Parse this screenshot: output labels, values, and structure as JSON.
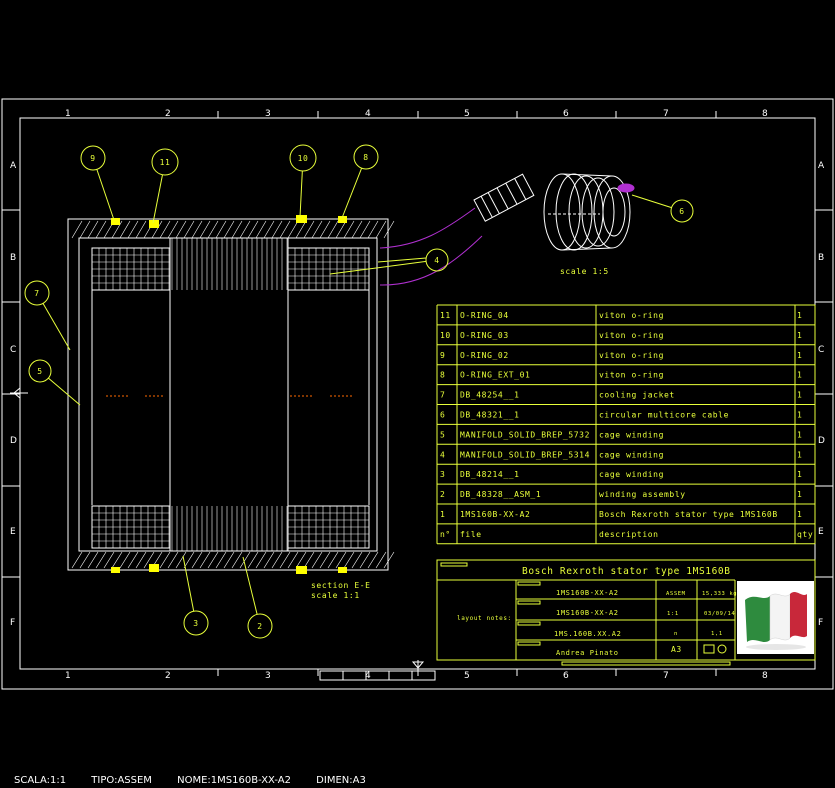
{
  "colors": {
    "border": "#ffffff",
    "yellow": "#e8ff3a",
    "part_yellow": "#ffff00",
    "purple": "#b030d0",
    "background": "#000000"
  },
  "frame": {
    "col_labels": [
      "1",
      "2",
      "3",
      "4",
      "5",
      "6",
      "7",
      "8"
    ],
    "row_labels": [
      "A",
      "B",
      "C",
      "D",
      "E",
      "F"
    ]
  },
  "balloons": [
    {
      "id": "balloon-9",
      "label": "9"
    },
    {
      "id": "balloon-11",
      "label": "11"
    },
    {
      "id": "balloon-10",
      "label": "10"
    },
    {
      "id": "balloon-8",
      "label": "8"
    },
    {
      "id": "balloon-4",
      "label": "4"
    },
    {
      "id": "balloon-6",
      "label": "6"
    },
    {
      "id": "balloon-7",
      "label": "7"
    },
    {
      "id": "balloon-5",
      "label": "5"
    },
    {
      "id": "balloon-3",
      "label": "3"
    },
    {
      "id": "balloon-2",
      "label": "2"
    }
  ],
  "views": {
    "section_label": "section E-E",
    "section_scale": "scale 1:1",
    "iso_scale": "scale 1:5"
  },
  "bom": {
    "rows": [
      {
        "n": "11",
        "file": "O-RING_04",
        "desc": "viton o-ring",
        "qty": "1"
      },
      {
        "n": "10",
        "file": "O-RING_03",
        "desc": "viton o-ring",
        "qty": "1"
      },
      {
        "n": "9",
        "file": "O-RING_02",
        "desc": "viton o-ring",
        "qty": "1"
      },
      {
        "n": "8",
        "file": "O-RING_EXT_01",
        "desc": "viton o-ring",
        "qty": "1"
      },
      {
        "n": "7",
        "file": "DB_48254__1",
        "desc": "cooling jacket",
        "qty": "1"
      },
      {
        "n": "6",
        "file": "DB_48321__1",
        "desc": "circular multicore cable",
        "qty": "1"
      },
      {
        "n": "5",
        "file": "MANIFOLD_SOLID_BREP_5732",
        "desc": "cage winding",
        "qty": "1"
      },
      {
        "n": "4",
        "file": "MANIFOLD_SOLID_BREP_5314",
        "desc": "cage winding",
        "qty": "1"
      },
      {
        "n": "3",
        "file": "DB_48214__1",
        "desc": "cage winding",
        "qty": "1"
      },
      {
        "n": "2",
        "file": "DB_48328__ASM_1",
        "desc": "winding assembly",
        "qty": "1"
      },
      {
        "n": "1",
        "file": "1MS160B-XX-A2",
        "desc": "Bosch Rexroth stator type 1MS160B",
        "qty": "1"
      }
    ],
    "header": {
      "n": "n°",
      "file": "file",
      "desc": "description",
      "qty": "qty"
    }
  },
  "title_block": {
    "title": "Bosch Rexroth stator type 1MS160B",
    "layout_notes": "layout notes:",
    "name1": "1MS160B-XX-A2",
    "name2": "1MS160B-XX-A2",
    "name3": "1MS.160B.XX.A2",
    "author": "Andrea Pinato",
    "type": "ASSEM",
    "mass": "15,333 kg",
    "scale": "1:1",
    "date": "03/09/14",
    "sheet_a": "n",
    "sheet_b": "1,1",
    "format": "A3"
  },
  "status_bar": {
    "scala": "SCALA:1:1",
    "tipo": "TIPO:ASSEM",
    "nome": "NOME:1MS160B-XX-A2",
    "dimen": "DIMEN:A3"
  }
}
